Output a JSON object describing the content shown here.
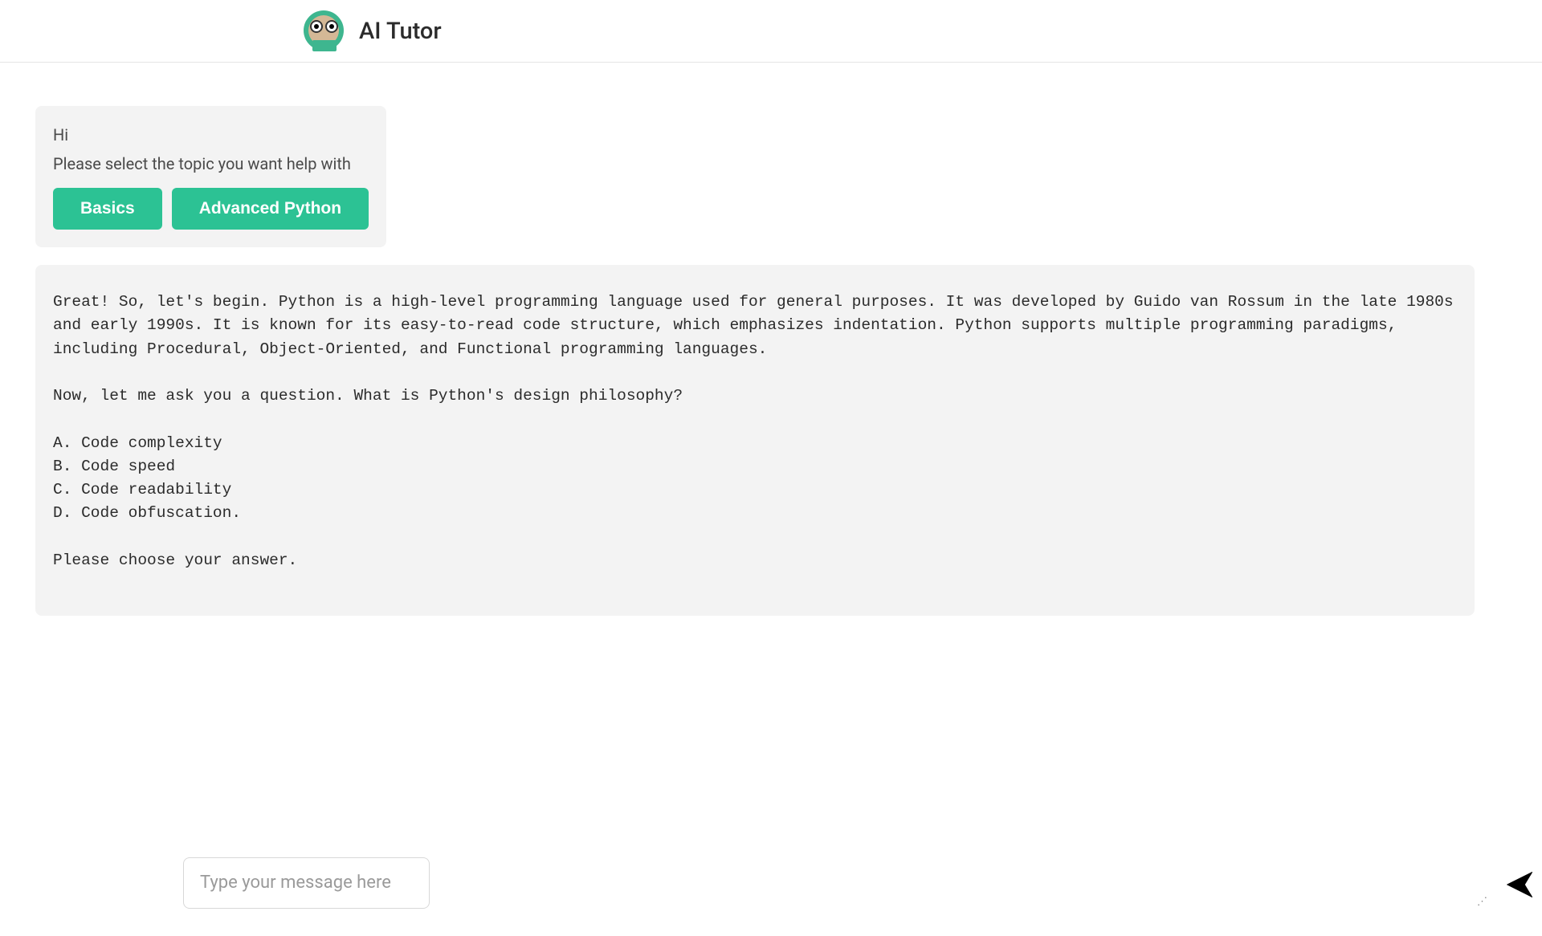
{
  "header": {
    "title": "AI Tutor"
  },
  "greeting": {
    "hi": "Hi",
    "select_prompt": "Please select the topic you want help with",
    "buttons": {
      "basics": "Basics",
      "advanced": "Advanced Python"
    }
  },
  "response": {
    "text": "Great! So, let's begin. Python is a high-level programming language used for general purposes. It was developed by Guido van Rossum in the late 1980s and early 1990s. It is known for its easy-to-read code structure, which emphasizes indentation. Python supports multiple programming paradigms, including Procedural, Object-Oriented, and Functional programming languages.\n\nNow, let me ask you a question. What is Python's design philosophy?\n\nA. Code complexity\nB. Code speed\nC. Code readability\nD. Code obfuscation.\n\nPlease choose your answer."
  },
  "input": {
    "placeholder": "Type your message here"
  }
}
